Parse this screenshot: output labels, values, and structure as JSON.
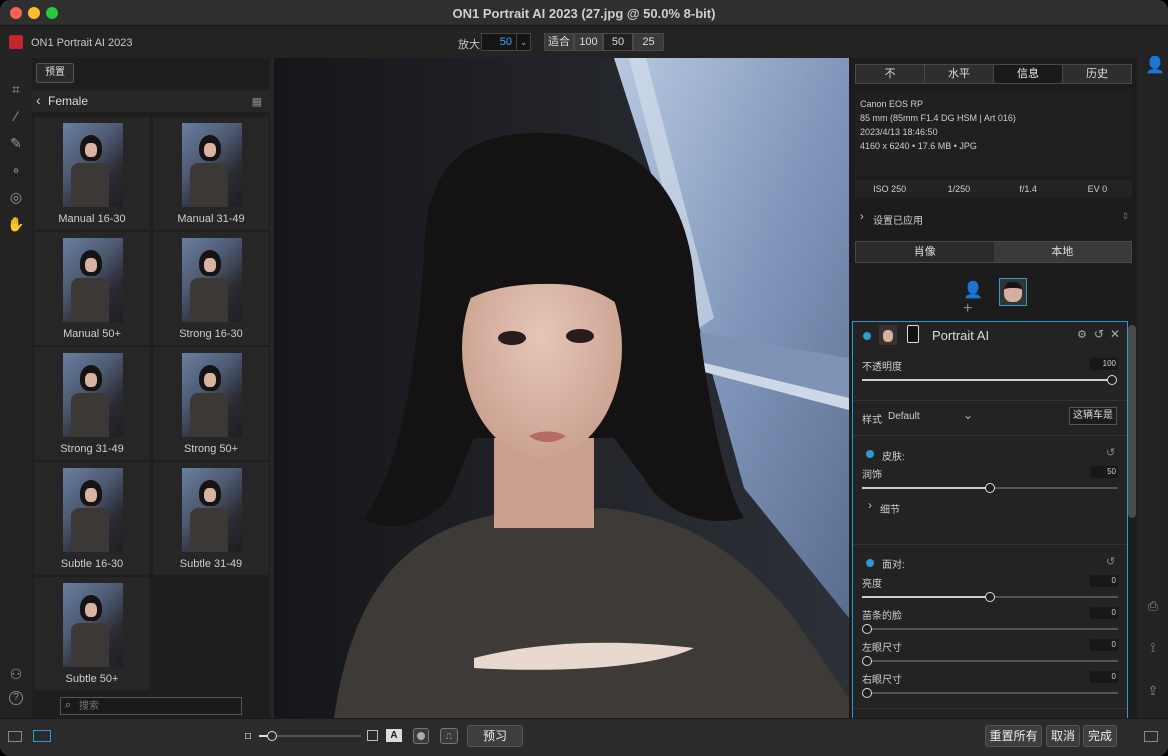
{
  "window": {
    "title": "ON1 Portrait AI 2023 (27.jpg @ 50.0% 8-bit)"
  },
  "toolbar": {
    "app_name": "ON1 Portrait AI 2023",
    "zoom_label": "放大",
    "zoom_value": "50",
    "zoom_presets": [
      "适合",
      "100",
      "50",
      "25"
    ]
  },
  "left_tools": [
    "crop-icon",
    "wand-icon",
    "brush-icon",
    "nodes-icon",
    "fingerprint-icon",
    "portrait-retouch-icon"
  ],
  "presets": {
    "button_label": "预置",
    "category": "Female",
    "items": [
      "Manual 16-30",
      "Manual 31-49",
      "Manual 50+",
      "Strong 16-30",
      "Strong 31-49",
      "Strong 50+",
      "Subtle 16-30",
      "Subtle 31-49",
      "Subtle 50+"
    ],
    "search_placeholder": "搜索"
  },
  "right_panel": {
    "top_tabs": [
      "不",
      "水平",
      "信息",
      "历史"
    ],
    "active_tab": "信息",
    "info": {
      "camera": "Canon EOS RP",
      "lens": "85 mm (85mm F1.4 DG HSM | Art 016)",
      "datetime": "2023/4/13  18:46:50",
      "dimensions": "4160 x 6240  •  17.6 MB  •  JPG"
    },
    "exif": [
      "ISO 250",
      "1/250",
      "f/1.4",
      "EV 0"
    ],
    "settings_applied": "设置已应用",
    "mode_tabs": [
      "肖像",
      "本地"
    ],
    "portrait_ai": {
      "title": "Portrait AI",
      "opacity_label": "不透明度",
      "opacity_value": "100",
      "opacity": 1.0,
      "style_label": "样式",
      "style_value": "Default",
      "style_button": "这辆车是",
      "skin": {
        "title": "皮肤:",
        "smooth_label": "润饰",
        "smooth_value": "50",
        "smooth": 0.5,
        "detail_label": "细节"
      },
      "face": {
        "title": "面对:",
        "sliders": [
          {
            "label": "亮度",
            "value": "0",
            "pos": 0.5
          },
          {
            "label": "苗条的脸",
            "value": "0",
            "pos": 0.0
          },
          {
            "label": "左眼尺寸",
            "value": "0",
            "pos": 0.0
          },
          {
            "label": "右眼尺寸",
            "value": "0",
            "pos": 0.0
          }
        ]
      }
    }
  },
  "right_strip": [
    "user-icon",
    "print-icon",
    "share-icon",
    "export-icon"
  ],
  "bottom": {
    "preview_label": "预习",
    "reset_all": "重置所有",
    "cancel": "取消",
    "done": "完成",
    "text_overlay_glyph": "A"
  }
}
